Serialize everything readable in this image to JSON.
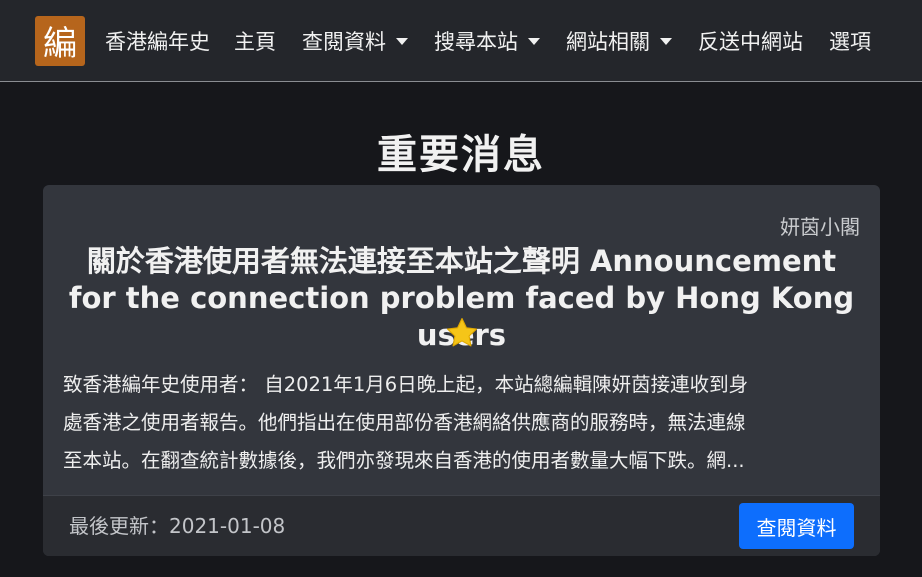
{
  "nav": {
    "logo_char": "編",
    "brand": "香港編年史",
    "items": [
      {
        "label": "主頁",
        "dropdown": false
      },
      {
        "label": "查閱資料",
        "dropdown": true
      },
      {
        "label": "搜尋本站",
        "dropdown": true
      },
      {
        "label": "網站相關",
        "dropdown": true
      },
      {
        "label": "反送中網站",
        "dropdown": false
      },
      {
        "label": "選項",
        "dropdown": false
      }
    ]
  },
  "page": {
    "title": "重要消息"
  },
  "card": {
    "author": "妍茵小閣",
    "title": "關於香港使用者無法連接至本站之聲明 Announcement for the connection problem faced by Hong Kong users",
    "star_icon": "star-icon",
    "text_lines": [
      "致香港編年史使用者： 自2021年1月6日晚上起，本站總編輯陳妍茵接連收到身",
      "處香港之使用者報告。他們指出在使用部份香港網絡供應商的服務時，無法連線",
      "至本站。在翻查統計數據後，我們亦發現來自香港的使用者數量大幅下跌。網..."
    ],
    "updated": "最後更新：2021-01-08",
    "button_label": "查閱資料"
  },
  "colors": {
    "background": "#16171b",
    "navbar": "#24262b",
    "logo": "#b6651c",
    "card": "#33363d",
    "card_footer": "#2a2c31",
    "primary_button": "#0d6efd",
    "star": "#f5c518"
  }
}
